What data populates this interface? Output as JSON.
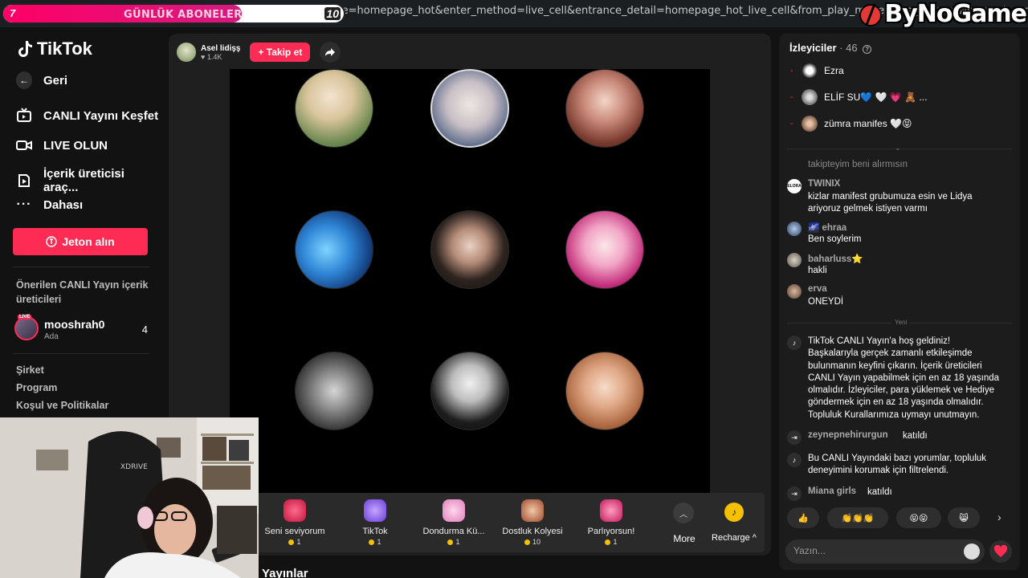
{
  "browser": {
    "url": "s?enter_from_merge=homepage_hot&enter_method=live_cell&entrance_detail=homepage_hot_live_cell&from_play_mode=one_column&is_guest_conne"
  },
  "overlay": {
    "sub_goal_current": "7",
    "sub_goal_label": "GÜNLÜK ABONELER",
    "sub_goal_target": "10",
    "sub_goal_progress": 0.7,
    "watermark": "ByNoGame"
  },
  "sidebar": {
    "logo": "TikTok",
    "back": "Geri",
    "items": [
      {
        "label": "CANLI Yayını Keşfet",
        "icon": "tv-icon"
      },
      {
        "label": "LIVE OLUN",
        "icon": "camera-icon"
      },
      {
        "label": "İçerik üreticisi araç...",
        "icon": "creator-tools-icon"
      },
      {
        "label": "Dahası",
        "icon": "more-dots-icon"
      }
    ],
    "jeton_button": "Jeton alın",
    "suggested_title": "Önerilen CANLI Yayın içerik üreticileri",
    "suggested": [
      {
        "name": "mooshrah0",
        "sub": "Ada",
        "count": "4"
      }
    ],
    "footer_links": [
      "Şirket",
      "Program",
      "Koşul ve Politikalar"
    ]
  },
  "live": {
    "host_name": "Asel lidişş",
    "host_likes": "1.4K",
    "follow_label": "+ Takip et",
    "gifts": [
      {
        "name": "Seni seviyorum",
        "cost": "1",
        "color": "#e8346a"
      },
      {
        "name": "TikTok",
        "cost": "1",
        "color": "#8a6cf0"
      },
      {
        "name": "Dondurma Kü...",
        "cost": "1",
        "color": "#f1a6d6"
      },
      {
        "name": "Dostluk Kolyesi",
        "cost": "10",
        "color": "#c8795a"
      },
      {
        "name": "Parlıyorsun!",
        "cost": "1",
        "color": "#e0457a"
      }
    ],
    "more_label": "More",
    "recharge_label": "Recharge ^",
    "section_title": "Yayınlar"
  },
  "chat": {
    "viewers_label": "İzleyiciler",
    "viewers_count": "· 46",
    "viewers": [
      {
        "name": "Ezra"
      },
      {
        "name": "ELİF SU💙 🤍 💗 🧸 ..."
      },
      {
        "name": "zümra manifes 🤍😝"
      }
    ],
    "messages": [
      {
        "user": "",
        "text": "takipteyim beni alırmısın"
      },
      {
        "user": "TWINIX",
        "text": "kizlar manifest grubumuza esin ve Lidya ariyoruz gelmek istiyen varmı"
      },
      {
        "user": "🌌 ehraa",
        "text": "Ben soylerim"
      },
      {
        "user": "baharluss⭐",
        "text": "hakli"
      },
      {
        "user": "erva",
        "text": "ONEYDİ"
      }
    ],
    "new_label": "Yeni",
    "welcome": "TikTok CANLI Yayın'a hoş geldiniz! Başkalarıyla gerçek zamanlı etkileşimde bulunmanın keyfini çıkarın. İçerik üreticileri CANLI Yayın yapabilmek için en az 18 yaşında olmalıdır. İzleyiciler, para yüklemek ve Hediye göndermek için en az 18 yaşında olmalıdır. Topluluk Kurallarımıza uymayı unutmayın.",
    "join1_user": "zeynepnehirurgun",
    "joined_label": "katıldı",
    "filter_notice": "Bu CANLI Yayındaki bazı yorumlar, topluluk deneyimini korumak için filtrelendi.",
    "join2_user": "Miana girls",
    "reactions": [
      "👍",
      "👏👏👏",
      "😝😝",
      "😸"
    ],
    "input_placeholder": "Yazın..."
  }
}
